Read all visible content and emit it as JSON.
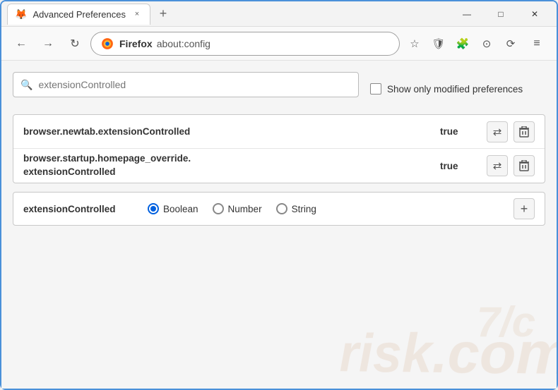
{
  "window": {
    "title": "Advanced Preferences",
    "tab_close": "×",
    "tab_new": "+",
    "minimize": "—",
    "maximize": "□",
    "close": "✕"
  },
  "nav": {
    "back": "←",
    "forward": "→",
    "reload": "↻",
    "firefox_label": "Firefox",
    "address": "about:config",
    "bookmark": "☆",
    "shield": "🛡",
    "extension": "🧩",
    "download": "⊙",
    "sync": "⟳",
    "menu": "≡"
  },
  "search": {
    "placeholder": "extensionControlled",
    "value": "extensionControlled",
    "show_modified_label": "Show only modified preferences"
  },
  "preferences": [
    {
      "name": "browser.newtab.extensionControlled",
      "value": "true",
      "multiline": false
    },
    {
      "name_line1": "browser.startup.homepage_override.",
      "name_line2": "extensionControlled",
      "value": "true",
      "multiline": true
    }
  ],
  "new_pref": {
    "name": "extensionControlled",
    "radio_options": [
      "Boolean",
      "Number",
      "String"
    ],
    "selected": "Boolean",
    "add_btn": "+"
  },
  "icons": {
    "search": "🔍",
    "reset": "⇄",
    "delete": "🗑",
    "radio_selected": "●",
    "radio_empty": "○"
  }
}
